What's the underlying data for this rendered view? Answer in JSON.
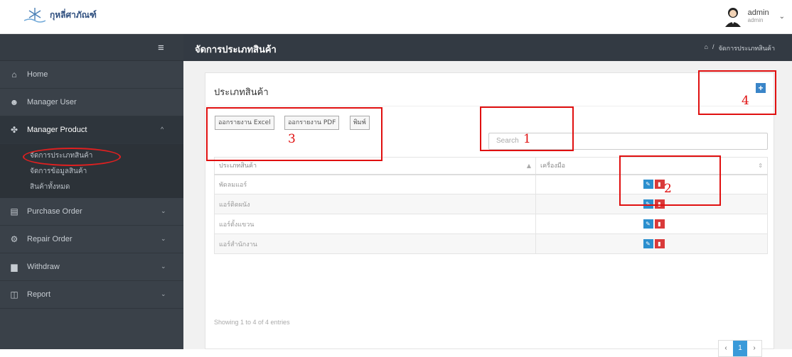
{
  "brand": {
    "name": "กุหลี่ศาภัณฑ์"
  },
  "user": {
    "name": "admin",
    "role": "admin"
  },
  "sidebar": {
    "items": [
      {
        "label": "Home",
        "icon": "home-icon"
      },
      {
        "label": "Manager User",
        "icon": "users-icon"
      },
      {
        "label": "Manager Product",
        "icon": "product-icon"
      },
      {
        "label": "Purchase Order",
        "icon": "purchase-icon"
      },
      {
        "label": "Repair Order",
        "icon": "repair-icon"
      },
      {
        "label": "Withdraw",
        "icon": "withdraw-icon"
      },
      {
        "label": "Report",
        "icon": "report-icon"
      }
    ],
    "sub_items": [
      {
        "label": "จัดการประเภทสินค้า"
      },
      {
        "label": "จัดการข้อมูลสินค้า"
      },
      {
        "label": "สินค้าทั้งหมด"
      }
    ]
  },
  "page": {
    "title": "จัดการประเภทสินค้า",
    "breadcrumb": "จัดการประเภทสินค้า",
    "breadcrumb_sep": "/"
  },
  "panel": {
    "title": "ประเภทสินค้า",
    "buttons": {
      "excel": "ออกรายงาน Excel",
      "pdf": "ออกรายงาน PDF",
      "print": "พิมพ์"
    },
    "search_placeholder": "Search",
    "table": {
      "headers": [
        "ประเภทสินค้า",
        "เครื่องมือ"
      ],
      "rows": [
        "พัดลมแอร์",
        "แอร์ติดผนัง",
        "แอร์ตั้งแขวน",
        "แอร์สำนักงาน"
      ]
    },
    "info": "Showing 1 to 4 of 4 entries",
    "pager": {
      "prev": "‹",
      "page": "1",
      "next": "›"
    }
  },
  "annotations": [
    "1",
    "2",
    "3",
    "4"
  ],
  "colors": {
    "sidebar": "#3a4149",
    "title_bar": "#333a43",
    "accent": "#3a9ad9",
    "annotation": "#e01010"
  }
}
